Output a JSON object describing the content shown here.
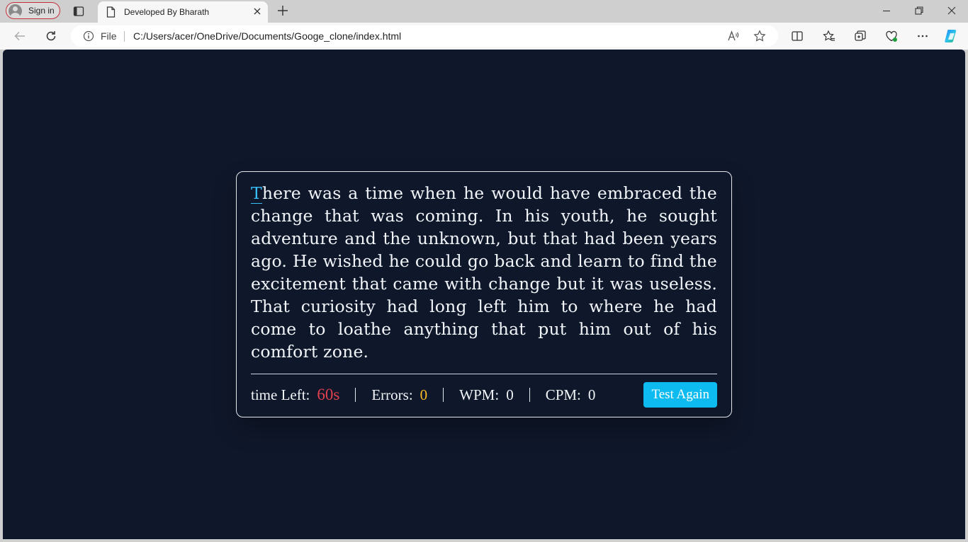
{
  "browser": {
    "signin_label": "Sign in",
    "tab_title": "Developed By Bharath",
    "file_label": "File",
    "url": "C:/Users/acer/OneDrive/Documents/Googe_clone/index.html",
    "read_aloud_label": "A"
  },
  "typing_test": {
    "paragraph_first_char": "T",
    "paragraph_rest": "here was a time when he would have embraced the change that was coming. In his youth, he sought adventure and the unknown, but that had been years ago. He wished he could go back and learn to find the excitement that came with change but it was useless. That curiosity had long left him to where he had come to loathe anything that put him out of his comfort zone.",
    "time_left_label": "time Left:",
    "time_left_value": "60s",
    "errors_label": "Errors:",
    "errors_value": "0",
    "wpm_label": "WPM:",
    "wpm_value": "0",
    "cpm_label": "CPM:",
    "cpm_value": "0",
    "test_again_label": "Test Again"
  },
  "colors": {
    "page_background": "#0f172a",
    "active_char": "#38bdf8",
    "time_value": "#e0414f",
    "errors_value": "#fbbf24",
    "button": "#0ebbf0"
  }
}
